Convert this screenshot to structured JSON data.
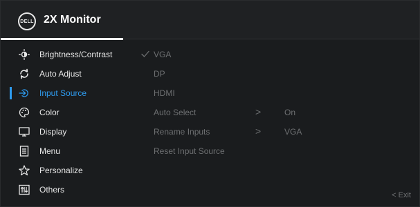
{
  "header": {
    "logo_text": "DELL",
    "title": "2X Monitor"
  },
  "menu": {
    "items": [
      {
        "label": "Brightness/Contrast",
        "icon": "brightness-icon"
      },
      {
        "label": "Auto Adjust",
        "icon": "auto-adjust-icon"
      },
      {
        "label": "Input Source",
        "icon": "input-source-icon"
      },
      {
        "label": "Color",
        "icon": "palette-icon"
      },
      {
        "label": "Display",
        "icon": "display-icon"
      },
      {
        "label": "Menu",
        "icon": "menu-icon"
      },
      {
        "label": "Personalize",
        "icon": "star-icon"
      },
      {
        "label": "Others",
        "icon": "others-icon"
      }
    ],
    "active_index": 2
  },
  "input_source": {
    "options": [
      {
        "label": "VGA",
        "checked": true
      },
      {
        "label": "DP",
        "checked": false
      },
      {
        "label": "HDMI",
        "checked": false
      },
      {
        "label": "Auto Select",
        "arrow": ">",
        "value": "On"
      },
      {
        "label": "Rename Inputs",
        "arrow": ">",
        "value": "VGA"
      },
      {
        "label": "Reset Input Source"
      }
    ]
  },
  "footer": {
    "exit_label": "< Exit"
  },
  "colors": {
    "accent": "#2e9bef",
    "background": "#1a1c1e",
    "text": "#e8e8e8",
    "dim_text": "#6e7072"
  }
}
